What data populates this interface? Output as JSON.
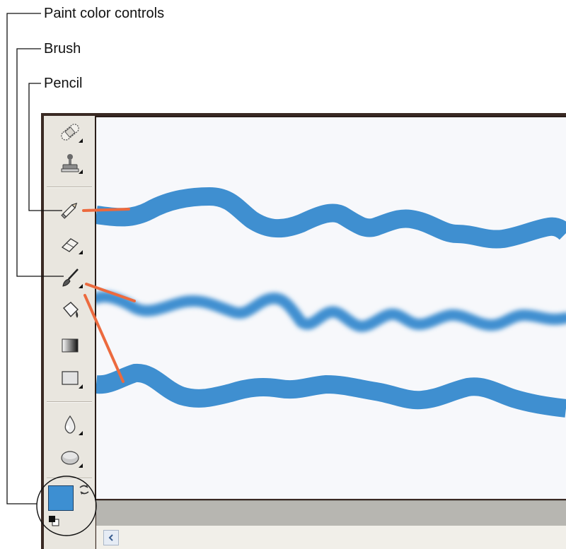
{
  "callouts": {
    "paint_color_controls": "Paint color controls",
    "brush": "Brush",
    "pencil": "Pencil"
  },
  "colors": {
    "stroke_blue": "#3f8fd0",
    "annotation_red": "#ec6a3e",
    "canvas_bg": "#f7f8fb",
    "toolbox_bg": "#e9e6df",
    "foreground_swatch": "#3d8fd2"
  },
  "toolbox": {
    "tools": [
      {
        "name": "healing-brush-tool",
        "icon": "bandage-icon",
        "submenu": true
      },
      {
        "name": "clone-stamp-tool",
        "icon": "stamp-icon",
        "submenu": true
      },
      {
        "name": "pencil-tool",
        "icon": "pencil-icon",
        "submenu": false
      },
      {
        "name": "eraser-tool",
        "icon": "eraser-icon",
        "submenu": true
      },
      {
        "name": "brush-tool",
        "icon": "brush-icon",
        "submenu": true
      },
      {
        "name": "paint-bucket-tool",
        "icon": "paint-bucket-icon",
        "submenu": false
      },
      {
        "name": "gradient-tool",
        "icon": "gradient-icon",
        "submenu": false
      },
      {
        "name": "shape-tool",
        "icon": "rectangle-icon",
        "submenu": true
      },
      {
        "name": "blur-tool",
        "icon": "water-drop-icon",
        "submenu": true
      },
      {
        "name": "sponge-tool",
        "icon": "sponge-icon",
        "submenu": true
      }
    ]
  },
  "color_controls": {
    "swap_icon": "swap-arrows-icon",
    "reset_icon": "default-colors-icon"
  },
  "scrollbar": {
    "left_icon": "chevron-left-icon"
  }
}
